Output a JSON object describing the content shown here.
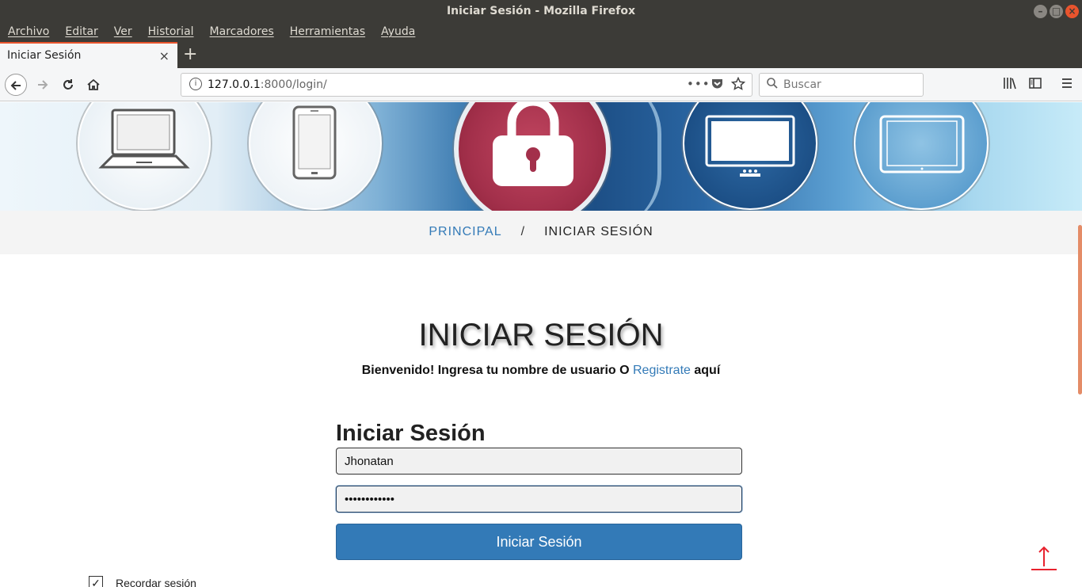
{
  "window": {
    "title": "Iniciar Sesión - Mozilla Firefox"
  },
  "menu": [
    "Archivo",
    "Editar",
    "Ver",
    "Historial",
    "Marcadores",
    "Herramientas",
    "Ayuda"
  ],
  "tab": {
    "title": "Iniciar Sesión",
    "close": "×",
    "new": "+"
  },
  "nav": {
    "url_host": "127.0.0.1",
    "url_rest": ":8000/login/",
    "search_placeholder": "Buscar"
  },
  "breadcrumb": {
    "home": "PRINCIPAL",
    "separator": "/",
    "current": "INICIAR SESIÓN"
  },
  "page": {
    "heading": "INICIAR SESIÓN",
    "welcome_prefix": "Bienvenido! Ingresa tu nombre de usuario O",
    "welcome_link": "Registrate",
    "welcome_suffix": "aquí"
  },
  "form": {
    "title": "Iniciar Sesión",
    "username_value": "Jhonatan",
    "password_value": "••••••••••••",
    "submit_label": "Iniciar Sesión",
    "remember_label": "Recordar sesión",
    "remember_checked": "✓"
  },
  "colors": {
    "accent": "#337ab7",
    "chrome": "#3c3b37",
    "tab_accent": "#e9542d",
    "scroll_top": "#e8222e"
  },
  "icons": [
    "back-icon",
    "forward-icon",
    "reload-icon",
    "home-icon",
    "info-icon",
    "more-icon",
    "pocket-icon",
    "star-icon",
    "search-icon",
    "library-icon",
    "sidebar-icon",
    "menu-icon",
    "scroll-top-icon"
  ]
}
